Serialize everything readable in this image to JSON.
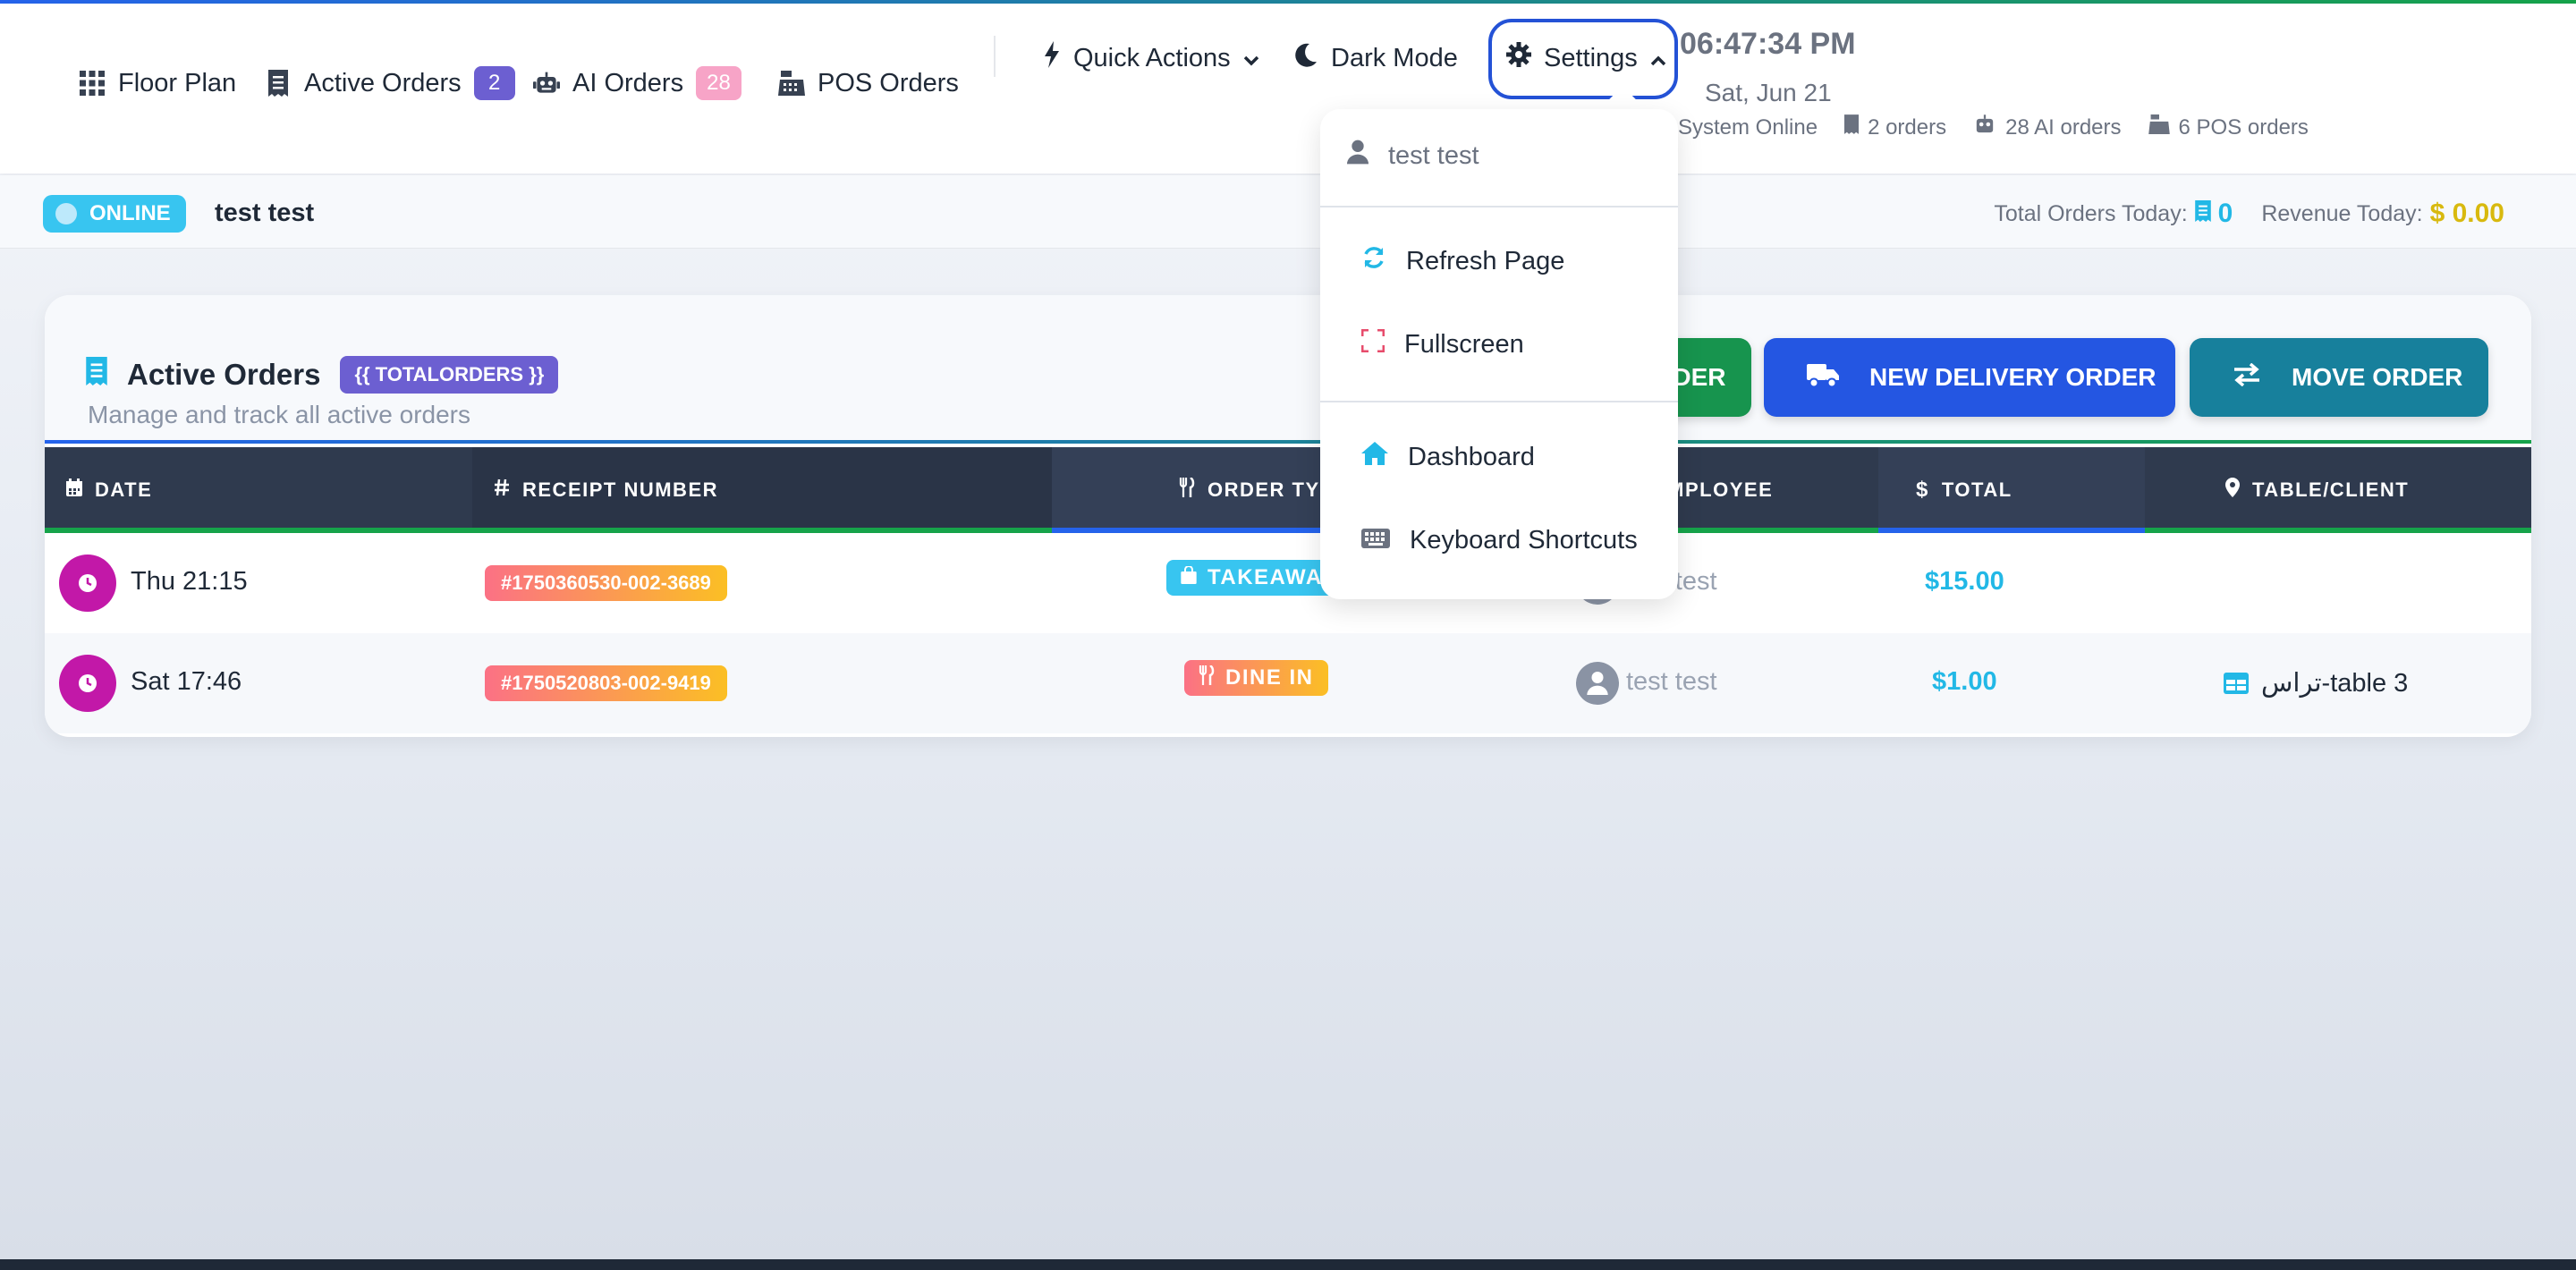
{
  "nav": {
    "floor_plan": "Floor Plan",
    "active_orders": "Active Orders",
    "active_orders_count": "2",
    "ai_orders": "AI Orders",
    "ai_orders_count": "28",
    "pos_orders": "POS Orders",
    "quick_actions": "Quick Actions",
    "dark_mode": "Dark Mode",
    "settings": "Settings"
  },
  "clock": {
    "time": "06:47:34 PM",
    "date": "Sat, Jun 21"
  },
  "status": {
    "system": "System Online",
    "orders": "2 orders",
    "ai_orders": "28 AI orders",
    "pos_orders": "6 POS orders"
  },
  "subbar": {
    "online_label": "ONLINE",
    "user": "test test",
    "total_orders_label": "Total Orders Today:",
    "total_orders_value": "0",
    "revenue_label": "Revenue Today:",
    "revenue_value": "$ 0.00"
  },
  "card": {
    "title": "Active Orders",
    "total_badge": "{{ TOTALORDERS }}",
    "subtitle": "Manage and track all active orders",
    "btn_takeaway": "NEW TAKEAWAY ORDER",
    "btn_delivery": "NEW DELIVERY ORDER",
    "btn_move": "MOVE ORDER"
  },
  "table": {
    "headers": {
      "date": "DATE",
      "receipt": "RECEIPT NUMBER",
      "order_type": "ORDER TYPE",
      "employee": "EMPLOYEE",
      "total": "TOTAL",
      "table_client": "TABLE/CLIENT"
    },
    "rows": [
      {
        "date": "Thu 21:15",
        "receipt": "#1750360530-002-3689",
        "type": "TAKEAWAY",
        "employee": "test test",
        "total": "$15.00",
        "table": ""
      },
      {
        "date": "Sat 17:46",
        "receipt": "#1750520803-002-9419",
        "type": "DINE IN",
        "employee": "test test",
        "total": "$1.00",
        "table": "تراس-table 3"
      }
    ]
  },
  "dropdown": {
    "user": "test test",
    "refresh": "Refresh Page",
    "fullscreen": "Fullscreen",
    "dashboard": "Dashboard",
    "shortcuts": "Keyboard Shortcuts"
  },
  "colors": {
    "accent_blue": "#2456e2",
    "accent_green": "#17944e",
    "accent_teal": "#17809c",
    "badge_purple": "#6c5fd1",
    "clock_magenta": "#c218a8",
    "cyan": "#22b8e6"
  }
}
